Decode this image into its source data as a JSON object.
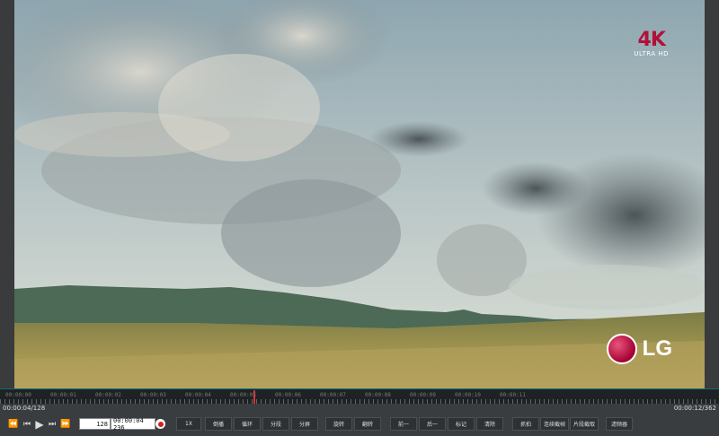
{
  "badge": {
    "big": "4K",
    "small": "ULTRA HD"
  },
  "logo": {
    "circle": "LG",
    "text": "LG"
  },
  "timeline": {
    "tick_labels": [
      "00:00:00",
      "00:00:01",
      "00:00:02",
      "00:00:03",
      "00:00:04",
      "00:00:05",
      "00:00:06",
      "00:00:07",
      "00:00:08",
      "00:00:09",
      "00:00:10",
      "00:00:11"
    ]
  },
  "status": {
    "current": "00:00:04/128",
    "total": "00:00:12/362"
  },
  "playback": {
    "rewind_icon": "⏪",
    "prev_frame_icon": "⏮",
    "play_icon": "▶",
    "next_frame_icon": "⏭",
    "forward_icon": "⏩",
    "frame_value": "128",
    "time_value": "00:00:04 236"
  },
  "buttons": {
    "speed": "1X",
    "reverse": "倒播",
    "loop": "循环",
    "split": "分段",
    "split_screen": "分屏",
    "rotate": "旋转",
    "flip": "翻转",
    "prev": "前一",
    "next": "后一",
    "mark": "标记",
    "clear": "清除",
    "capture": "抓拍",
    "continuous_capture": "连续截帧",
    "clip_capture": "片段截取",
    "filter": "滤频器"
  },
  "colors": {
    "accent": "#0f6f70",
    "playhead": "#e03030",
    "brand": "#a50034"
  }
}
